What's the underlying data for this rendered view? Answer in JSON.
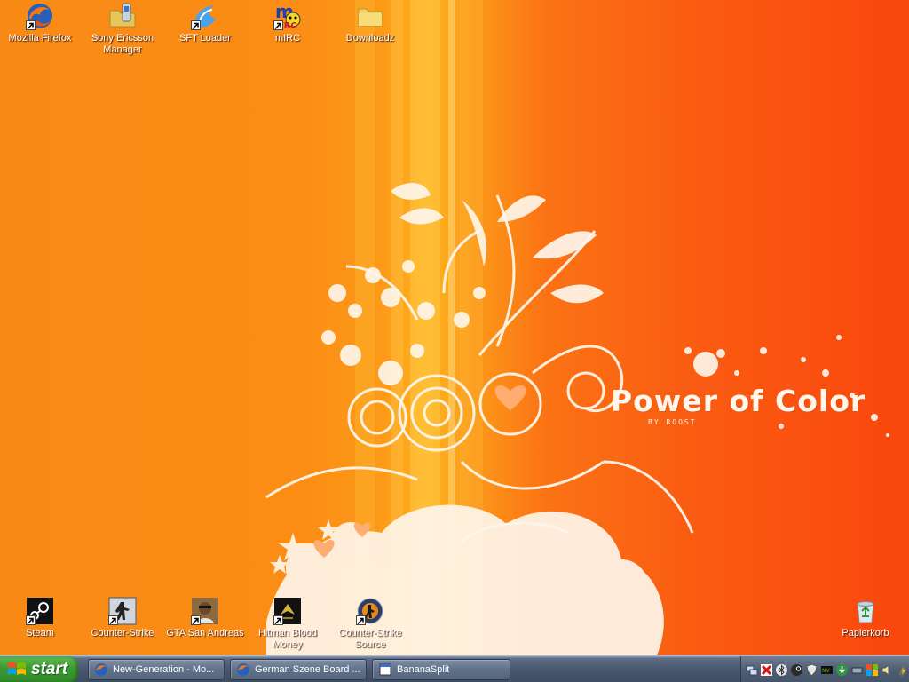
{
  "desktop": {
    "wallpaper_title": "Power of Color",
    "wallpaper_subtitle": "BY ROOST",
    "icons_top": [
      {
        "label": "Mozilla Firefox",
        "icon": "firefox-icon"
      },
      {
        "label": "Sony Ericsson Manager",
        "icon": "phone-folder-icon"
      },
      {
        "label": "SFT Loader",
        "icon": "sft-loader-icon"
      },
      {
        "label": "mIRC",
        "icon": "mirc-icon"
      },
      {
        "label": "Downloadz",
        "icon": "folder-icon"
      }
    ],
    "icons_bottom": [
      {
        "label": "Steam",
        "icon": "steam-icon"
      },
      {
        "label": "Counter-Strike",
        "icon": "counter-strike-icon"
      },
      {
        "label": "GTA San Andreas",
        "icon": "gta-icon"
      },
      {
        "label": "Hitman Blood Money",
        "icon": "hitman-icon"
      },
      {
        "label": "Counter-Strike Source",
        "icon": "cs-source-icon"
      },
      {
        "label": "Papierkorb",
        "icon": "recycle-bin-icon"
      }
    ]
  },
  "taskbar": {
    "start_label": "start",
    "tasks": [
      {
        "title": "New-Generation - Mo...",
        "icon": "firefox-icon"
      },
      {
        "title": "German Szene Board ...",
        "icon": "firefox-icon"
      },
      {
        "title": "BananaSplit",
        "icon": "window-icon"
      }
    ],
    "tray_icons": [
      "network-icon",
      "antivirus-icon",
      "bluetooth-icon",
      "steam-tray-icon",
      "security-shield-icon",
      "nvidia-icon",
      "downloader-icon",
      "safely-remove-icon",
      "update-icon",
      "volume-icon",
      "battery-icon"
    ]
  },
  "colors": {
    "wallpaper_left": "#f98a16",
    "wallpaper_center": "#ffb21f",
    "wallpaper_right": "#f9470d",
    "taskbar": "#49586f",
    "start_green": "#3c9a33"
  }
}
